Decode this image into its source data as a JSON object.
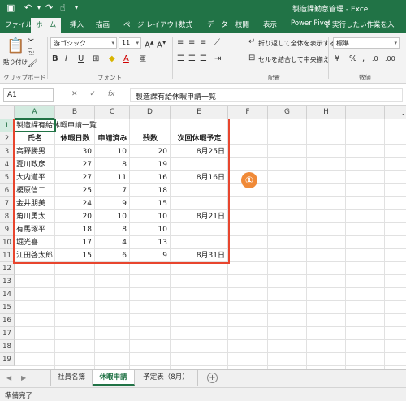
{
  "window": {
    "title": "製造課勤怠管理 - Excel"
  },
  "quick_access": {
    "save_icon": "save-icon",
    "undo_icon": "undo-icon",
    "redo_icon": "redo-icon",
    "touch_icon": "touch-mode-icon",
    "more_icon": "customize-icon"
  },
  "ribbon_tabs": [
    "ファイル",
    "ホーム",
    "挿入",
    "描画",
    "ページ レイアウト",
    "数式",
    "データ",
    "校閲",
    "表示",
    "Power Pivot"
  ],
  "ribbon_active_tab": "ホーム",
  "tell_me": "実行したい作業を入",
  "ribbon": {
    "clipboard": {
      "paste_label": "貼り付け",
      "group_label": "クリップボード"
    },
    "font": {
      "font_name": "游ゴシック",
      "font_size": "11",
      "bold": "B",
      "italic": "I",
      "underline": "U",
      "group_label": "フォント"
    },
    "alignment": {
      "wrap_text": "折り返して全体を表示する",
      "merge_center": "セルを結合して中央揃え",
      "group_label": "配置"
    },
    "number": {
      "format": "標準",
      "percent": "%",
      "comma": ",",
      "group_label": "数値"
    }
  },
  "formula_bar": {
    "name_box": "A1",
    "cancel": "✕",
    "enter": "✓",
    "fx": "fx",
    "content": "製造課有給休暇申請一覧"
  },
  "columns": [
    "A",
    "B",
    "C",
    "D",
    "E",
    "F",
    "G",
    "H",
    "I",
    "J"
  ],
  "rows": [
    "1",
    "2",
    "3",
    "4",
    "5",
    "6",
    "7",
    "8",
    "9",
    "10",
    "11",
    "12",
    "13",
    "14",
    "15",
    "16",
    "17",
    "18",
    "19"
  ],
  "sheet": {
    "title": "製造課有給休暇申請一覧",
    "headers": [
      "氏名",
      "休暇日数",
      "申請済み",
      "残数",
      "次回休暇予定"
    ],
    "records": [
      [
        "高野勝男",
        "30",
        "10",
        "20",
        "8月25日"
      ],
      [
        "夏川政彦",
        "27",
        "8",
        "19",
        ""
      ],
      [
        "大内道平",
        "27",
        "11",
        "16",
        "8月16日"
      ],
      [
        "榎原信二",
        "25",
        "7",
        "18",
        ""
      ],
      [
        "金井朋美",
        "24",
        "9",
        "15",
        ""
      ],
      [
        "角川勇太",
        "20",
        "10",
        "10",
        "8月21日"
      ],
      [
        "有馬琢平",
        "18",
        "8",
        "10",
        ""
      ],
      [
        "堀光喜",
        "17",
        "4",
        "13",
        ""
      ],
      [
        "江田啓太郎",
        "15",
        "6",
        "9",
        "8月31日"
      ]
    ]
  },
  "callout": "①",
  "sheet_tabs": [
    "社員名簿",
    "休暇申請",
    "予定表（8月）"
  ],
  "active_sheet": "休暇申請",
  "nav": {
    "prev": "◀",
    "next": "▶",
    "add": "+"
  },
  "status": "準備完了",
  "colors": {
    "excel_green": "#217346",
    "annotation_red": "#e8452e",
    "annotation_orange": "#f08a38"
  }
}
